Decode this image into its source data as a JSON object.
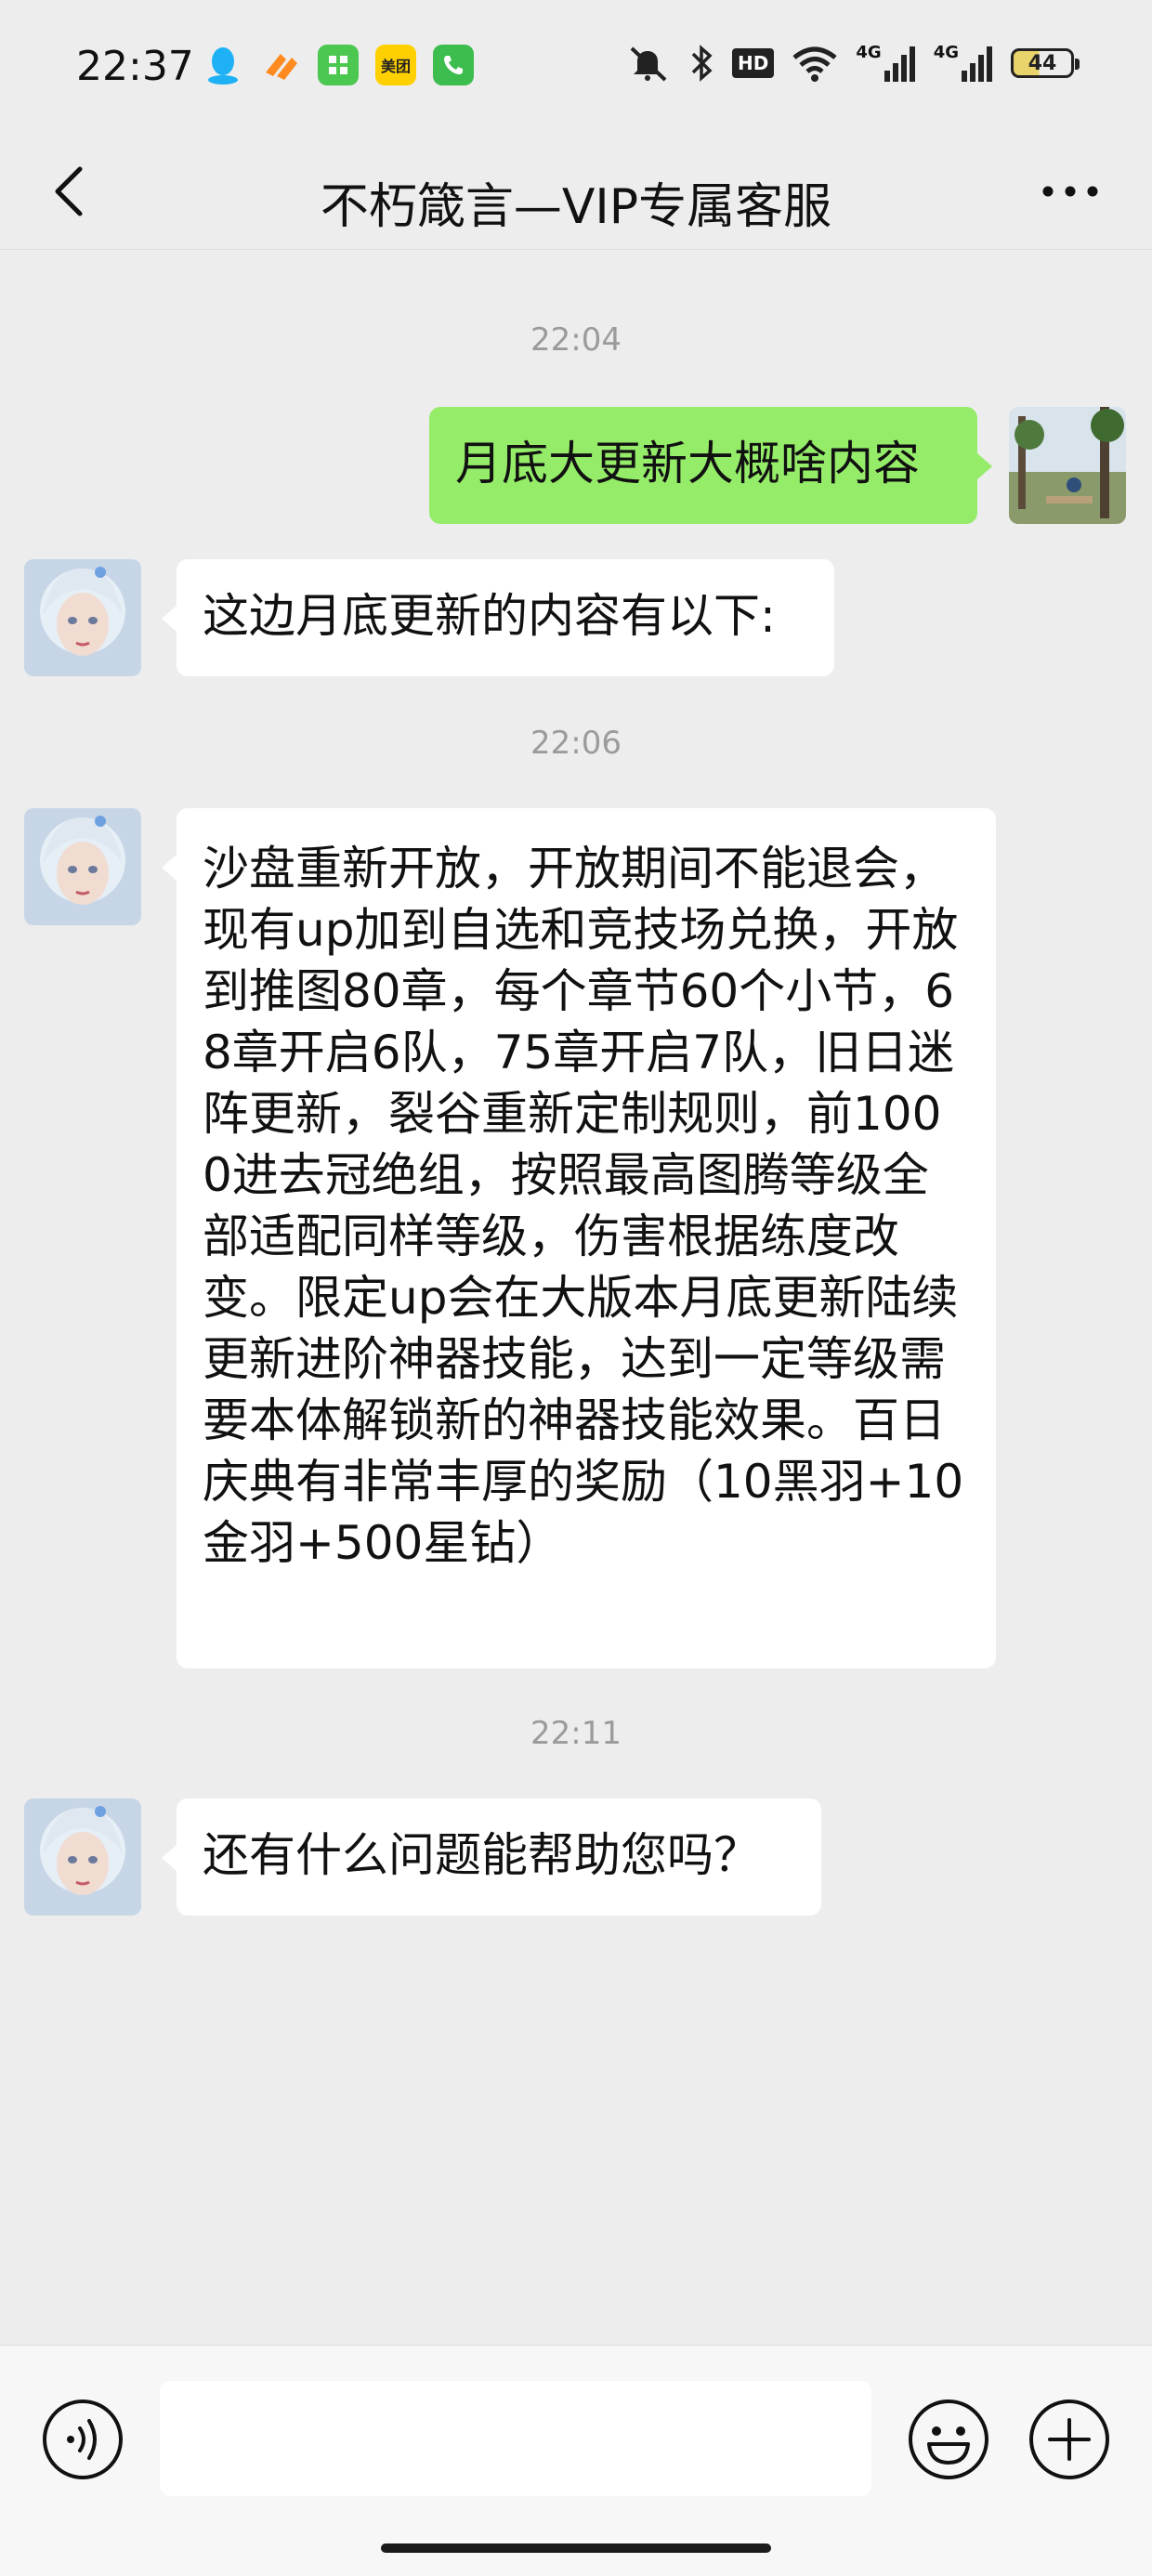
{
  "status_bar": {
    "time": "22:37",
    "app_icons": [
      "qq-icon",
      "app-orange-icon",
      "app-green-icon",
      "meituan-icon",
      "phone-icon"
    ],
    "meituan_label": "美团",
    "hd_label": "HD",
    "signal_label_1": "4G",
    "signal_label_2": "4G",
    "battery": "44"
  },
  "header": {
    "title": "不朽箴言—VIP专属客服"
  },
  "messages": {
    "ts1": "22:04",
    "m1": "月底大更新大概啥内容",
    "m2": "这边月底更新的内容有以下:",
    "ts2": "22:06",
    "m3": "沙盘重新开放，开放期间不能退会，现有up加到自选和竞技场兑换，开放到推图80章，每个章节60个小节，68章开启6队，75章开启7队，旧日迷阵更新，裂谷重新定制规则，前1000进去冠绝组，按照最高图腾等级全部适配同样等级，伤害根据练度改变。限定up会在大版本月底更新陆续更新进阶神器技能，达到一定等级需要本体解锁新的神器技能效果。百日庆典有非常丰厚的奖励（10黑羽+10金羽+500星钻）",
    "ts3": "22:11",
    "m4": "还有什么问题能帮助您吗？"
  },
  "input_bar": {
    "value": "",
    "placeholder": ""
  },
  "colors": {
    "background": "#ededed",
    "outgoing_bubble": "#95ec69",
    "incoming_bubble": "#ffffff",
    "timestamp": "#9b9b9b"
  }
}
